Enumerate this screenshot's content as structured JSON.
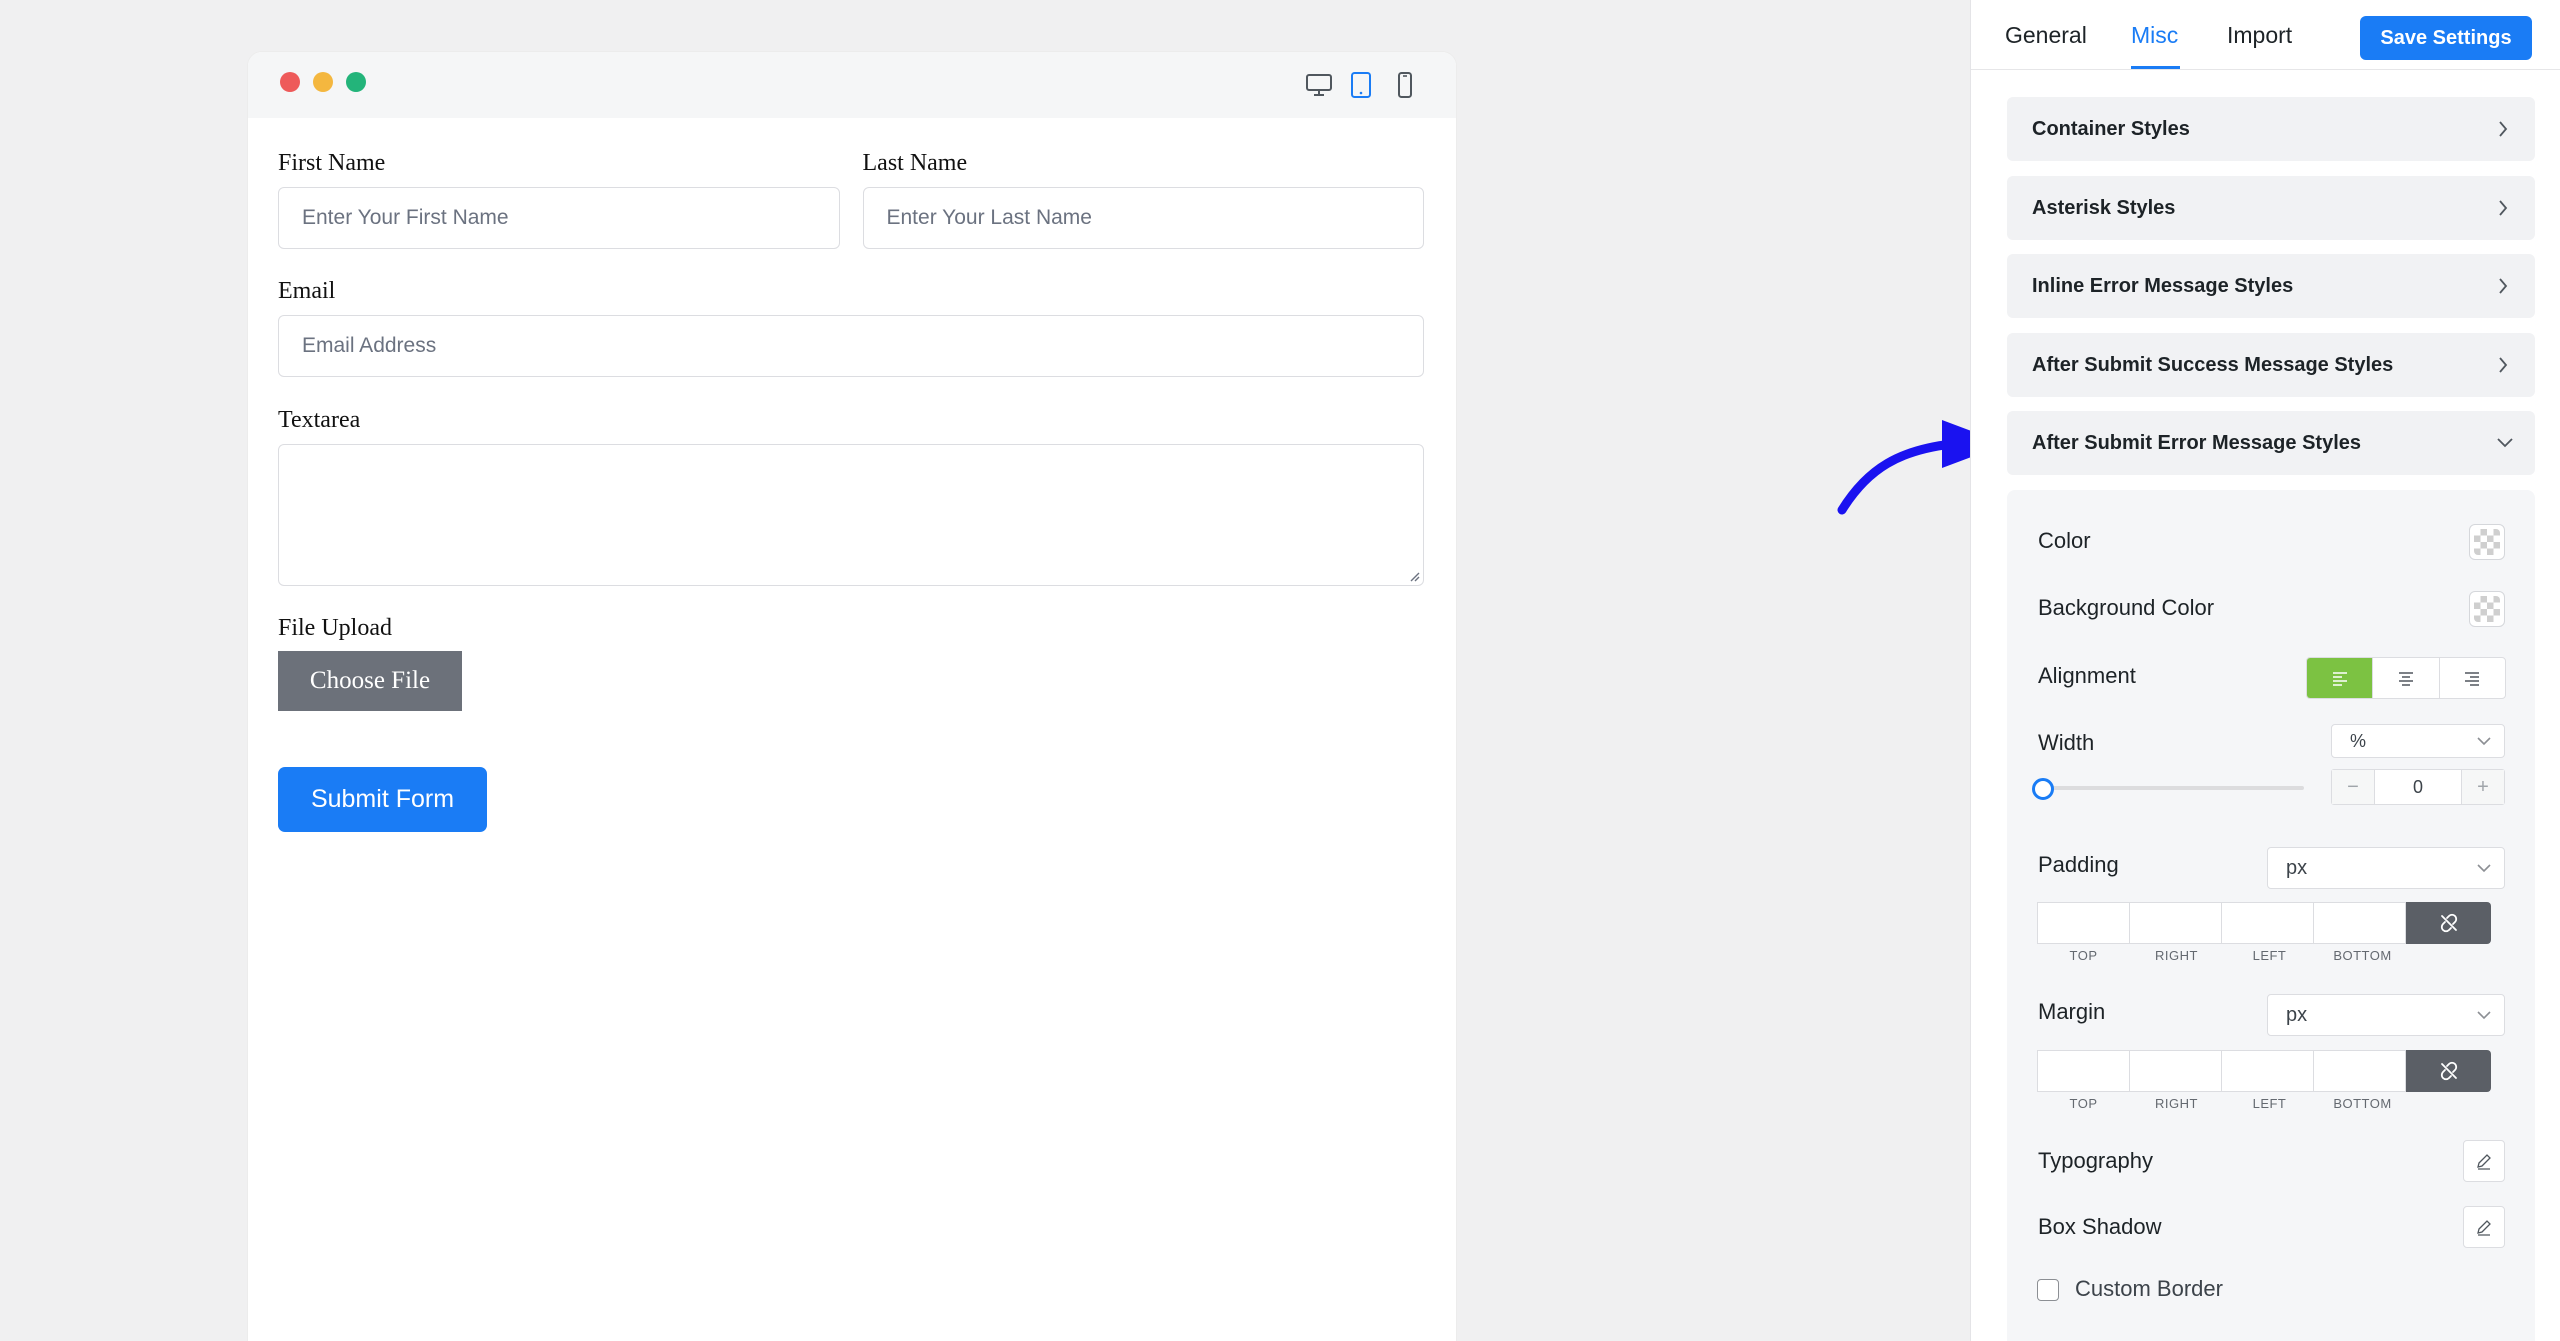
{
  "preview": {
    "device_icons": [
      "desktop-icon",
      "tablet-icon",
      "mobile-icon"
    ],
    "active_device": "tablet",
    "form": {
      "first_name_label": "First Name",
      "first_name_placeholder": "Enter Your First Name",
      "last_name_label": "Last Name",
      "last_name_placeholder": "Enter Your Last Name",
      "email_label": "Email",
      "email_placeholder": "Email Address",
      "textarea_label": "Textarea",
      "file_label": "File Upload",
      "file_button": "Choose File",
      "submit_label": "Submit Form"
    }
  },
  "panel": {
    "tabs": [
      "General",
      "Misc",
      "Import"
    ],
    "active_tab": "Misc",
    "save_label": "Save Settings",
    "sections": [
      "Container Styles",
      "Asterisk Styles",
      "Inline Error Message Styles",
      "After Submit Success Message Styles",
      "After Submit Error Message Styles"
    ],
    "open_section": "After Submit Error Message Styles",
    "props": {
      "color_label": "Color",
      "bg_color_label": "Background Color",
      "alignment_label": "Alignment",
      "alignment_value": "left",
      "width_label": "Width",
      "width_unit": "%",
      "width_value": "0",
      "padding_label": "Padding",
      "padding_unit": "px",
      "margin_label": "Margin",
      "margin_unit": "px",
      "dim_labels": [
        "TOP",
        "RIGHT",
        "LEFT",
        "BOTTOM"
      ],
      "typography_label": "Typography",
      "box_shadow_label": "Box Shadow",
      "custom_border_label": "Custom Border"
    }
  },
  "colors": {
    "accent": "#1a7cf5",
    "active_align": "#7cc242",
    "annotation_arrow": "#1a12f0"
  }
}
